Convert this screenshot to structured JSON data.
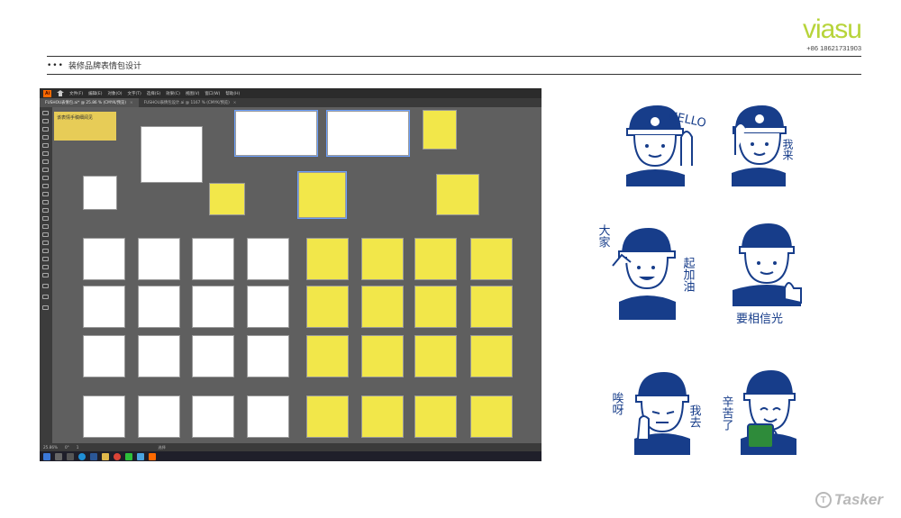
{
  "brand": {
    "logo": "viasu",
    "phone": "+86 18621731903"
  },
  "header": {
    "bullet": "•••",
    "title": "装修品牌表情包设计"
  },
  "app": {
    "menu": [
      "文件(F)",
      "编辑(E)",
      "对象(O)",
      "文字(T)",
      "选择(S)",
      "效果(C)",
      "视图(V)",
      "窗口(W)",
      "帮助(H)"
    ],
    "tabs": [
      {
        "label": "FUSHOU表情包.ai* @ 25.86 % (CMYK/预览)",
        "active": true
      },
      {
        "label": "FUSHOU表情包设计.ai @ 1167 % (CMYK/预览)",
        "active": false
      }
    ],
    "note": "该表情手稿细阅见",
    "status": {
      "zoom": "25.86%",
      "angle": "0°",
      "page": "1",
      "mode": "选择"
    }
  },
  "stickers": {
    "hello": "HELLO",
    "wolai": "我来",
    "dajia": "大家",
    "qijiayou": "起加油",
    "xiangxin": "要相信光",
    "aiya": "唉呀",
    "woqu": "我去",
    "xinkule": "辛苦了"
  },
  "colors": {
    "navy": "#173d8a",
    "yellow": "#f2e74a",
    "green": "#b7d43a"
  },
  "watermark": "Tasker"
}
